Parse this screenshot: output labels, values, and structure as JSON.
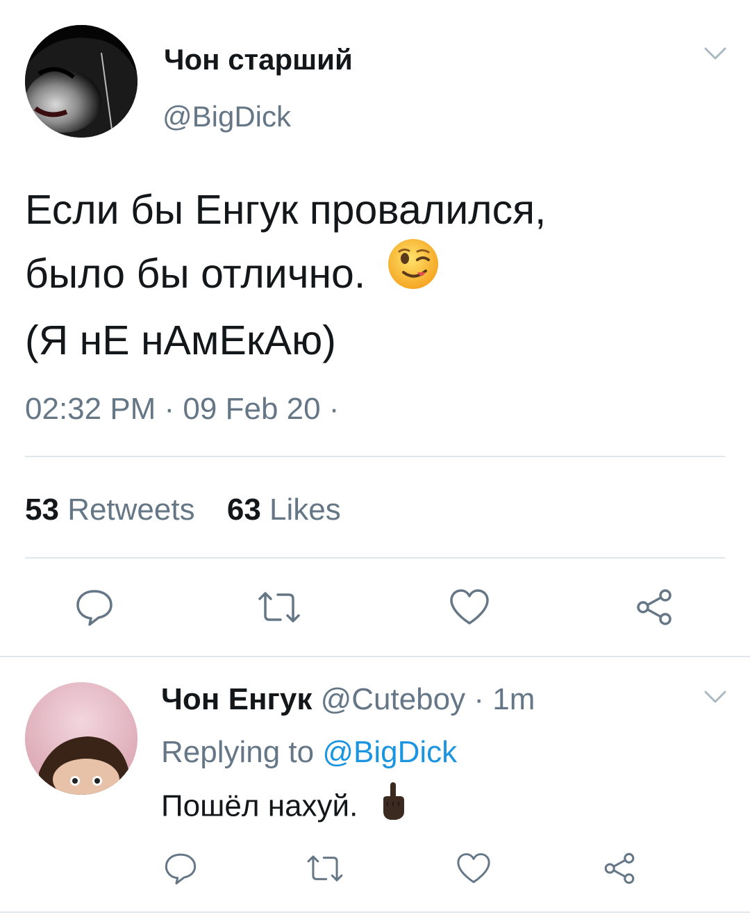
{
  "main_tweet": {
    "display_name": "Чон старший",
    "handle": "@BigDick",
    "text_lines": [
      "Если бы Енгук провалился,",
      "было бы отлично.",
      "(Я нЕ нАмЕкАю)"
    ],
    "emoji": "winking-face-emoji",
    "meta": "02:32 PM · 09 Feb 20 ·",
    "retweets_count": "53",
    "retweets_label": "Retweets",
    "likes_count": "63",
    "likes_label": "Likes"
  },
  "reply_tweet": {
    "display_name": "Чон Енгук",
    "handle": "@Cuteboy",
    "time": "· 1m",
    "replying_prefix": "Replying to",
    "replying_handle": "@BigDick",
    "text": "Пошёл нахуй.",
    "emoji": "middle-finger-emoji"
  },
  "colors": {
    "text": "#14171a",
    "muted": "#657786",
    "link": "#1b95e0",
    "divider": "#e1e8ed",
    "icon": "#657786"
  },
  "icons": [
    "chevron-down-icon",
    "reply-icon",
    "retweet-icon",
    "like-icon",
    "share-icon"
  ]
}
